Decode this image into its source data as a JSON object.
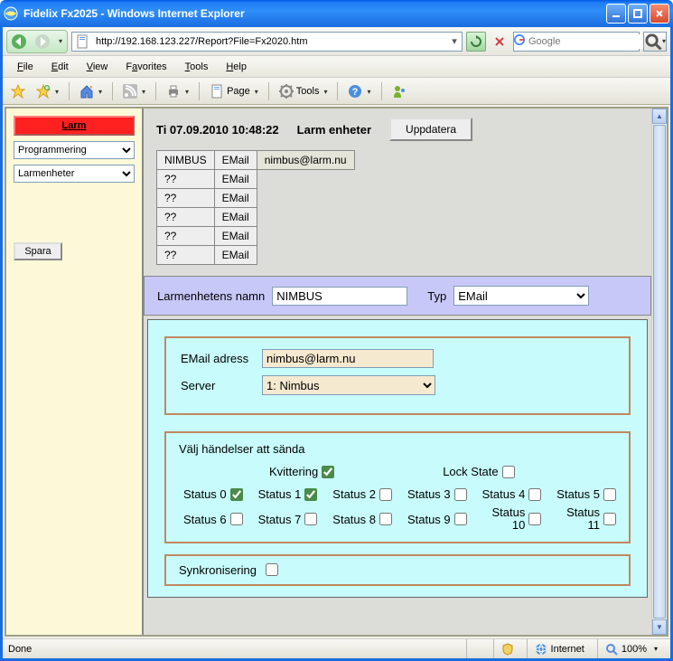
{
  "window": {
    "title": "Fidelix Fx2025 - Windows Internet Explorer"
  },
  "address": {
    "url": "http://192.168.123.227/Report?File=Fx2020.htm"
  },
  "search": {
    "placeholder": "Google"
  },
  "menu": {
    "file": "File",
    "edit": "Edit",
    "view": "View",
    "favorites": "Favorites",
    "tools": "Tools",
    "help": "Help"
  },
  "toolbar": {
    "page": "Page",
    "tools": "Tools"
  },
  "sidebar": {
    "larm": "Larm",
    "select1": "Programmering",
    "select2": "Larmenheter",
    "spara": "Spara"
  },
  "main": {
    "datetime": "Ti 07.09.2010 10:48:22",
    "section_title": "Larm enheter",
    "update_btn": "Uppdatera",
    "table": {
      "rows": [
        {
          "c0": "NIMBUS",
          "c1": "EMail",
          "c2": "nimbus@larm.nu"
        },
        {
          "c0": "??",
          "c1": "EMail",
          "c2": ""
        },
        {
          "c0": "??",
          "c1": "EMail",
          "c2": ""
        },
        {
          "c0": "??",
          "c1": "EMail",
          "c2": ""
        },
        {
          "c0": "??",
          "c1": "EMail",
          "c2": ""
        },
        {
          "c0": "??",
          "c1": "EMail",
          "c2": ""
        }
      ]
    },
    "name_label": "Larmenhetens namn",
    "name_value": "NIMBUS",
    "typ_label": "Typ",
    "typ_value": "EMail",
    "email_label": "EMail adress",
    "email_value": "nimbus@larm.nu",
    "server_label": "Server",
    "server_value": "1: Nimbus",
    "events_title": "Välj händelser att sända",
    "kvittering": "Kvittering",
    "lockstate": "Lock State",
    "statuses": {
      "s0": "Status 0",
      "s1": "Status 1",
      "s2": "Status 2",
      "s3": "Status 3",
      "s4": "Status 4",
      "s5": "Status 5",
      "s6": "Status 6",
      "s7": "Status 7",
      "s8": "Status 8",
      "s9": "Status 9",
      "s10": "Status 10",
      "s11": "Status 11"
    },
    "checked": {
      "kvittering": true,
      "lockstate": false,
      "s0": true,
      "s1": true
    },
    "sync_label": "Synkronisering"
  },
  "status": {
    "done": "Done",
    "zone": "Internet",
    "zoom": "100%"
  }
}
